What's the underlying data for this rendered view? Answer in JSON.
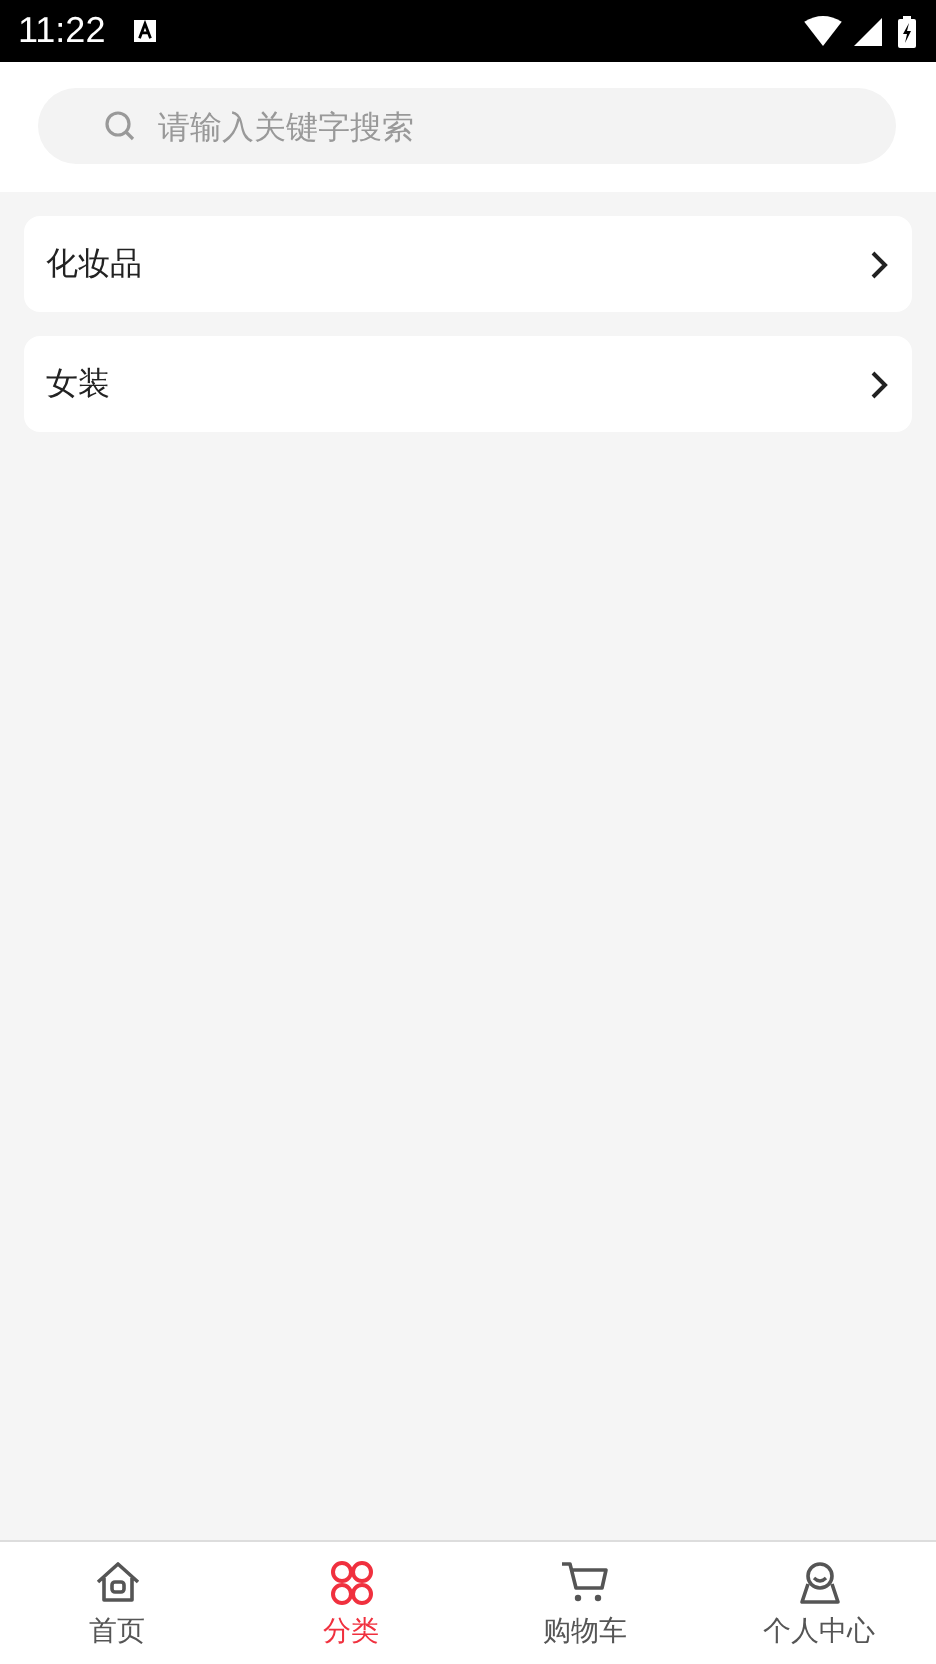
{
  "status_bar": {
    "time": "11:22"
  },
  "search": {
    "placeholder": "请输入关键字搜索"
  },
  "categories": [
    {
      "label": "化妆品"
    },
    {
      "label": "女装"
    }
  ],
  "tabs": [
    {
      "label": "首页",
      "kind": "home",
      "selected": false
    },
    {
      "label": "分类",
      "kind": "category",
      "selected": true
    },
    {
      "label": "购物车",
      "kind": "cart",
      "selected": false
    },
    {
      "label": "个人中心",
      "kind": "profile",
      "selected": false
    }
  ]
}
